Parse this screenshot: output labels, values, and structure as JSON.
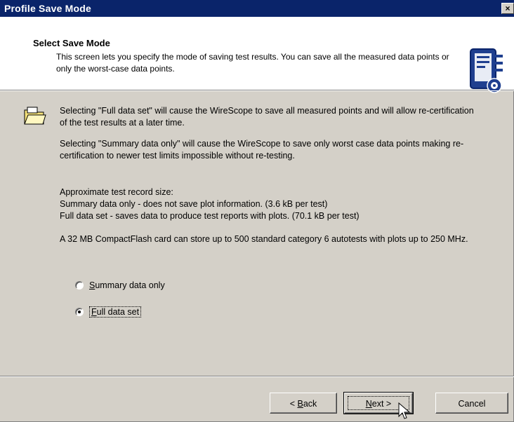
{
  "window": {
    "title": "Profile Save Mode",
    "close_label": "×"
  },
  "header": {
    "title": "Select Save Mode",
    "description": "This screen lets you specify the mode of saving test results.  You can save all the measured data points or only the worst-case data points."
  },
  "body": {
    "para_full": "Selecting \"Full data set\" will cause the WireScope to save all measured points and will allow re-certification of the test results at a later time.",
    "para_summary": "Selecting \"Summary data only\" will cause the WireScope to save only worst case data points making re-certification to newer test limits impossible without re-testing.",
    "size_heading": "Approximate test record size:",
    "size_summary": "Summary data only - does not save plot information. (3.6 kB per test)",
    "size_full": "Full data set - saves data to produce test reports with plots. (70.1 kB per test)",
    "card_note": "A 32 MB CompactFlash card can store up to 500 standard category 6 autotests with plots up to 250 MHz."
  },
  "options": {
    "summary": {
      "mnemonic": "S",
      "rest": "ummary data only",
      "checked": false
    },
    "full": {
      "mnemonic": "F",
      "rest": "ull data set",
      "checked": true
    }
  },
  "buttons": {
    "back_prefix": "< ",
    "back_mnemonic": "B",
    "back_rest": "ack",
    "next_mnemonic": "N",
    "next_rest": "ext >",
    "cancel": "Cancel"
  }
}
